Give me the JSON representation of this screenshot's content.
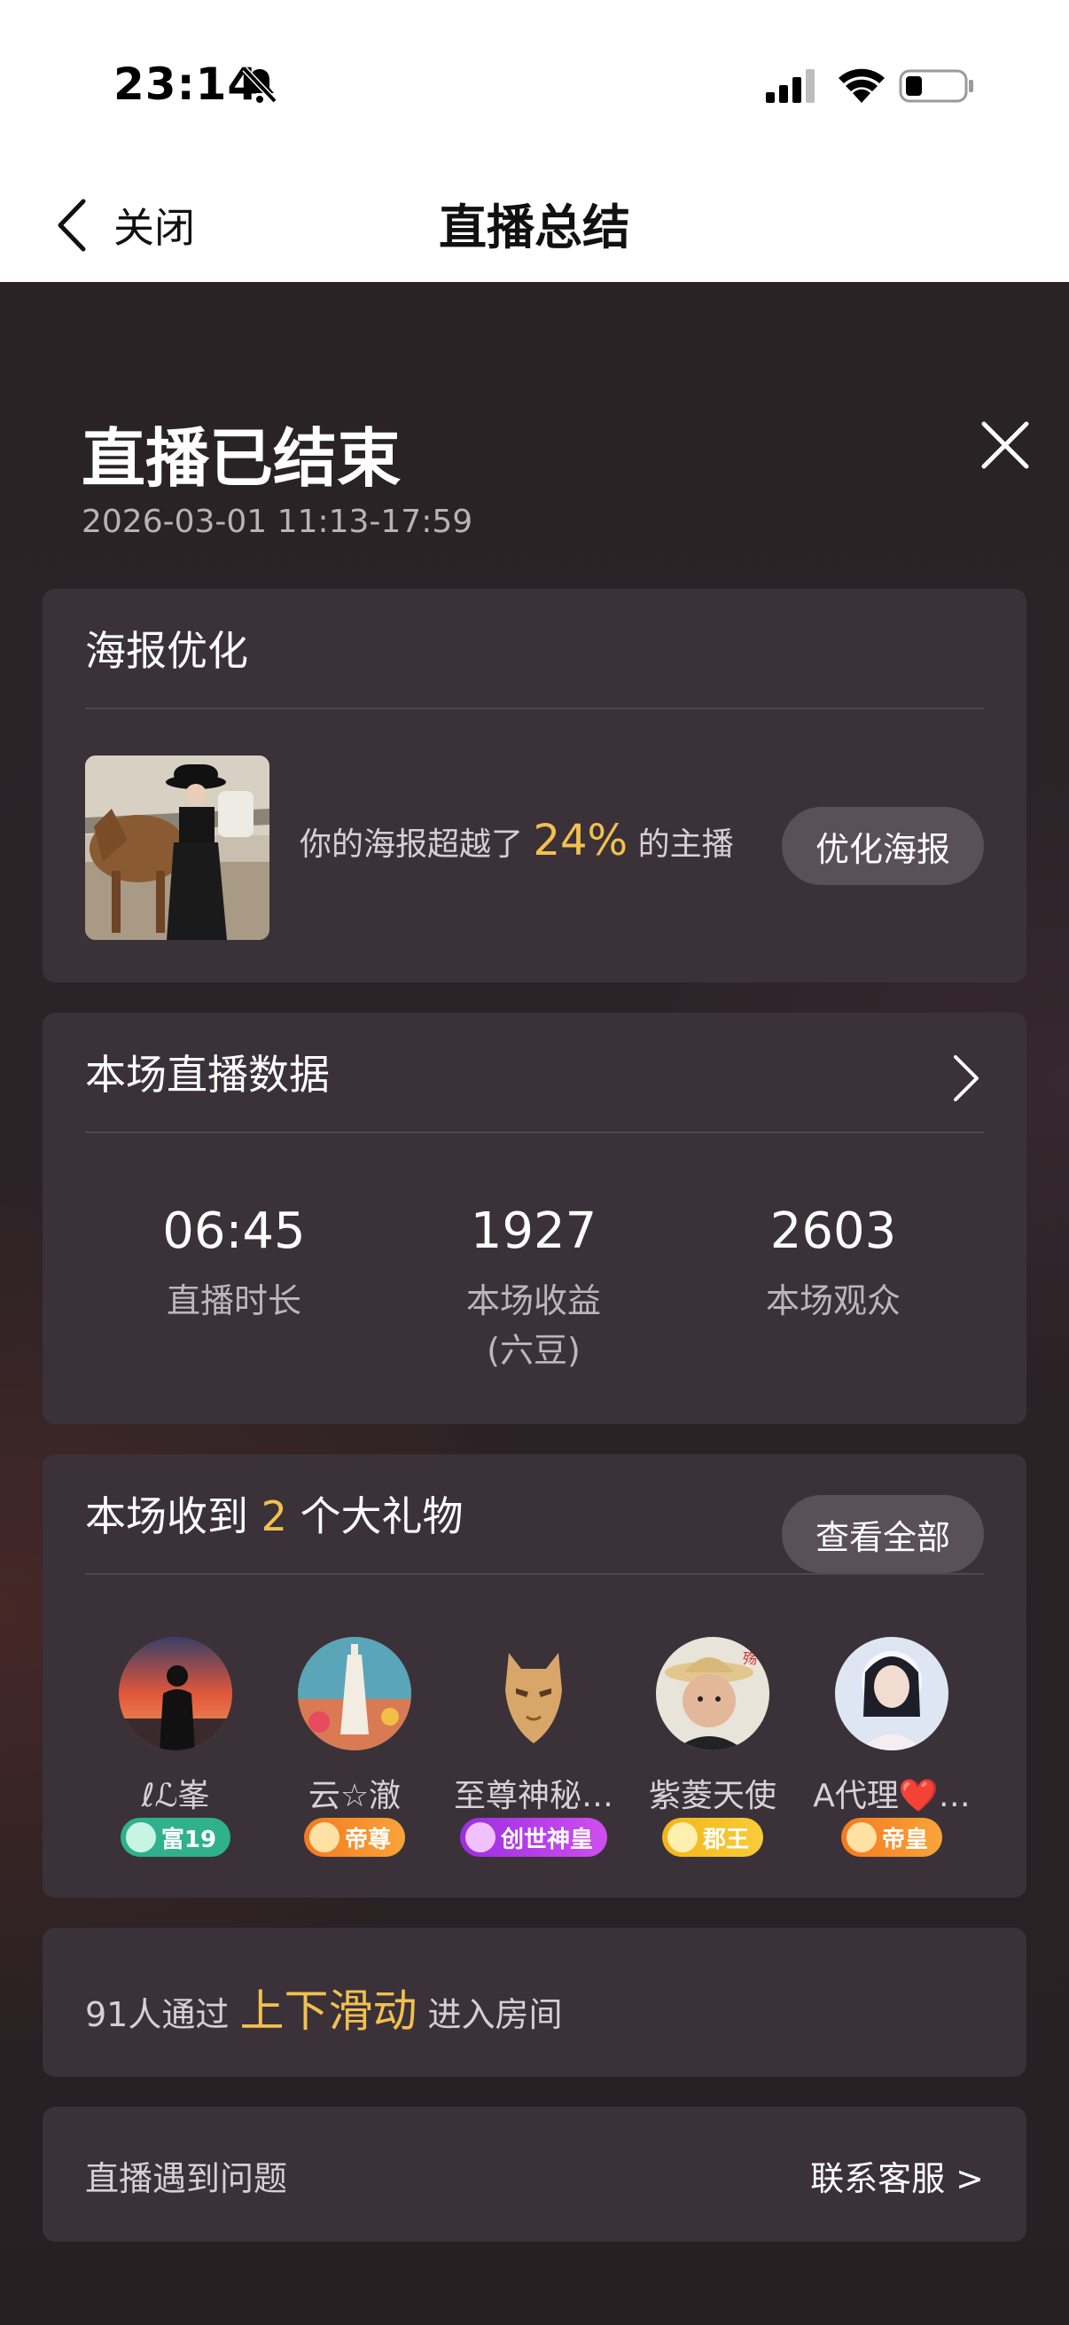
{
  "status": {
    "time": "23:14"
  },
  "nav": {
    "back_label": "关闭",
    "title": "直播总结"
  },
  "summary": {
    "title": "直播已结束",
    "time_range": "2026-03-01 11:13-17:59"
  },
  "poster": {
    "title": "海报优化",
    "text_before": "你的海报超越了",
    "percent": "24%",
    "text_after": "的主播",
    "button": "优化海报"
  },
  "stats": {
    "title": "本场直播数据",
    "items": [
      {
        "value": "06:45",
        "label": "直播时长",
        "sub": ""
      },
      {
        "value": "1927",
        "label": "本场收益",
        "sub": "(六豆)"
      },
      {
        "value": "2603",
        "label": "本场观众",
        "sub": ""
      }
    ]
  },
  "gifts": {
    "title_before": "本场收到",
    "count": "2",
    "title_after": "个大礼物",
    "view_all": "查看全部",
    "gifters": [
      {
        "name": "ℓℒ峯",
        "badge": "富19",
        "badge_color": "#2fb18d"
      },
      {
        "name": "云☆澈",
        "badge": "帝尊",
        "badge_color": "#f47a1f"
      },
      {
        "name": "至尊神秘…",
        "badge": "创世神皇",
        "badge_color": "#9b2ee0"
      },
      {
        "name": "紫菱天使",
        "badge": "郡王",
        "badge_color": "#f3b619"
      },
      {
        "name": "A代理❤️…",
        "badge": "帝皇",
        "badge_color": "#f47a1f"
      }
    ]
  },
  "swipe": {
    "text_before": "91人通过",
    "highlight": "上下滑动",
    "text_after": "进入房间"
  },
  "support": {
    "text": "直播遇到问题",
    "link": "联系客服 >"
  },
  "colors": {
    "accent": "#f3c04f",
    "card_bg": "#3a3238",
    "panel_bg": "#2a2326"
  }
}
